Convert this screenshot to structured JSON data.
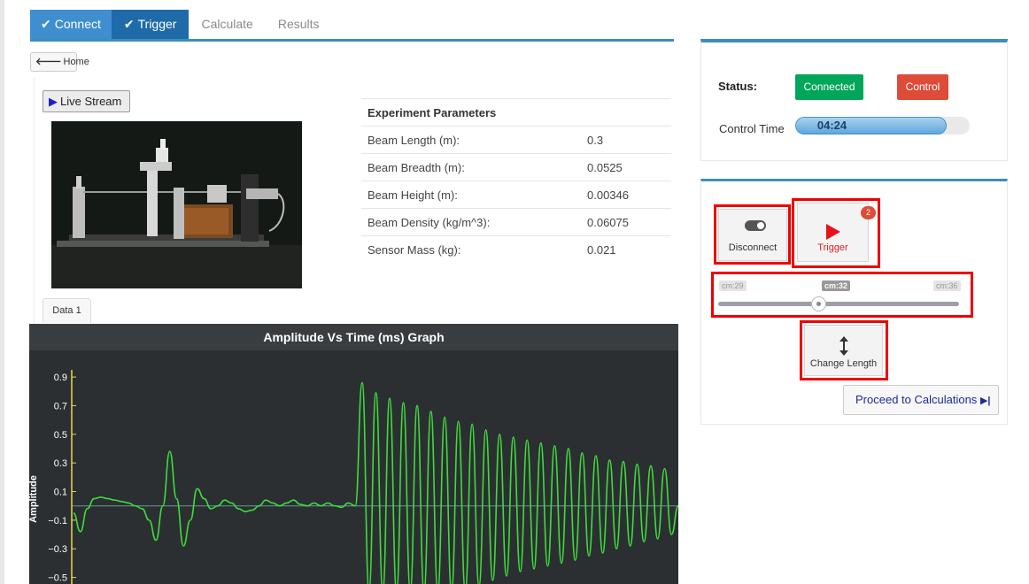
{
  "tabs": [
    {
      "label": "Connect",
      "state": "done"
    },
    {
      "label": "Trigger",
      "state": "active"
    },
    {
      "label": "Calculate",
      "state": "inactive"
    },
    {
      "label": "Results",
      "state": "inactive"
    }
  ],
  "tab_check": "✔",
  "home_label": "Home",
  "home_arrow": "🡐",
  "live_stream_label": "Live Stream",
  "params": {
    "header": "Experiment Parameters",
    "rows": [
      {
        "label": "Beam Length (m):",
        "value": "0.3"
      },
      {
        "label": "Beam Breadth (m):",
        "value": "0.0525"
      },
      {
        "label": "Beam Height (m):",
        "value": "0.00346"
      },
      {
        "label": "Beam Density (kg/m^3):",
        "value": "0.06075"
      },
      {
        "label": "Sensor Mass (kg):",
        "value": "0.021"
      }
    ]
  },
  "data_tab_label": "Data 1",
  "status": {
    "label": "Status:",
    "connected_label": "Connected",
    "control_label": "Control",
    "control_time_label": "Control Time",
    "control_time_value": "04:24",
    "control_time_fraction": 0.87
  },
  "controls": {
    "disconnect_label": "Disconnect",
    "trigger_label": "Trigger",
    "trigger_count": "2",
    "slider_min_label": "cm:29",
    "slider_value_label": "cm:32",
    "slider_max_label": "cm:36",
    "slider_min": 29,
    "slider_max": 36,
    "slider_value": 32,
    "change_length_label": "Change Length",
    "proceed_label": "Proceed to Calculations"
  },
  "colors": {
    "accent": "#3c8dbc",
    "connected": "#00a65a",
    "control": "#dd4b39",
    "signal": "#3ddc3d"
  },
  "chart_data": {
    "type": "line",
    "title": "Amplitude Vs Time (ms) Graph",
    "ylabel": "Amplitude",
    "xlabel": "",
    "ylim": [
      -0.62,
      0.95
    ],
    "yticks": [
      0.9,
      0.7,
      0.5,
      0.3,
      0.1,
      -0.1,
      -0.3,
      -0.5
    ],
    "ytick_labels": [
      "0.9",
      "0.7",
      "0.5",
      "0.3",
      "0.1",
      "−0.1",
      "−0.3",
      "−0.5"
    ],
    "grid": false,
    "series": [
      {
        "values": [
          -0.05,
          -0.18,
          -0.02,
          0.05,
          0.06,
          0.05,
          0.04,
          0.03,
          0.02,
          0.0,
          -0.02,
          -0.1,
          -0.24,
          0.0,
          0.38,
          0.05,
          -0.28,
          -0.1,
          0.12,
          0.05,
          -0.02,
          0.0,
          0.04,
          0.02,
          -0.02,
          -0.04,
          -0.03,
          0.0,
          0.04,
          0.02,
          0.0,
          0.02,
          0.04,
          0.01,
          0.0,
          0.02,
          0.0,
          0.02,
          0.0,
          -0.01,
          0.02,
          0.0,
          0.86,
          -0.59,
          0.79,
          -0.59,
          0.75,
          -0.59,
          0.72,
          -0.59,
          0.7,
          -0.59,
          0.66,
          -0.59,
          0.62,
          -0.59,
          0.59,
          -0.59,
          0.57,
          -0.56,
          0.53,
          -0.52,
          0.5,
          -0.49,
          0.48,
          -0.46,
          0.46,
          -0.44,
          0.44,
          -0.42,
          0.42,
          -0.4,
          0.4,
          -0.38,
          0.37,
          -0.35,
          0.35,
          -0.33,
          0.32,
          -0.3,
          0.31,
          -0.28,
          0.29,
          -0.25,
          0.28,
          -0.23,
          0.26,
          -0.2,
          0.0
        ]
      }
    ]
  }
}
